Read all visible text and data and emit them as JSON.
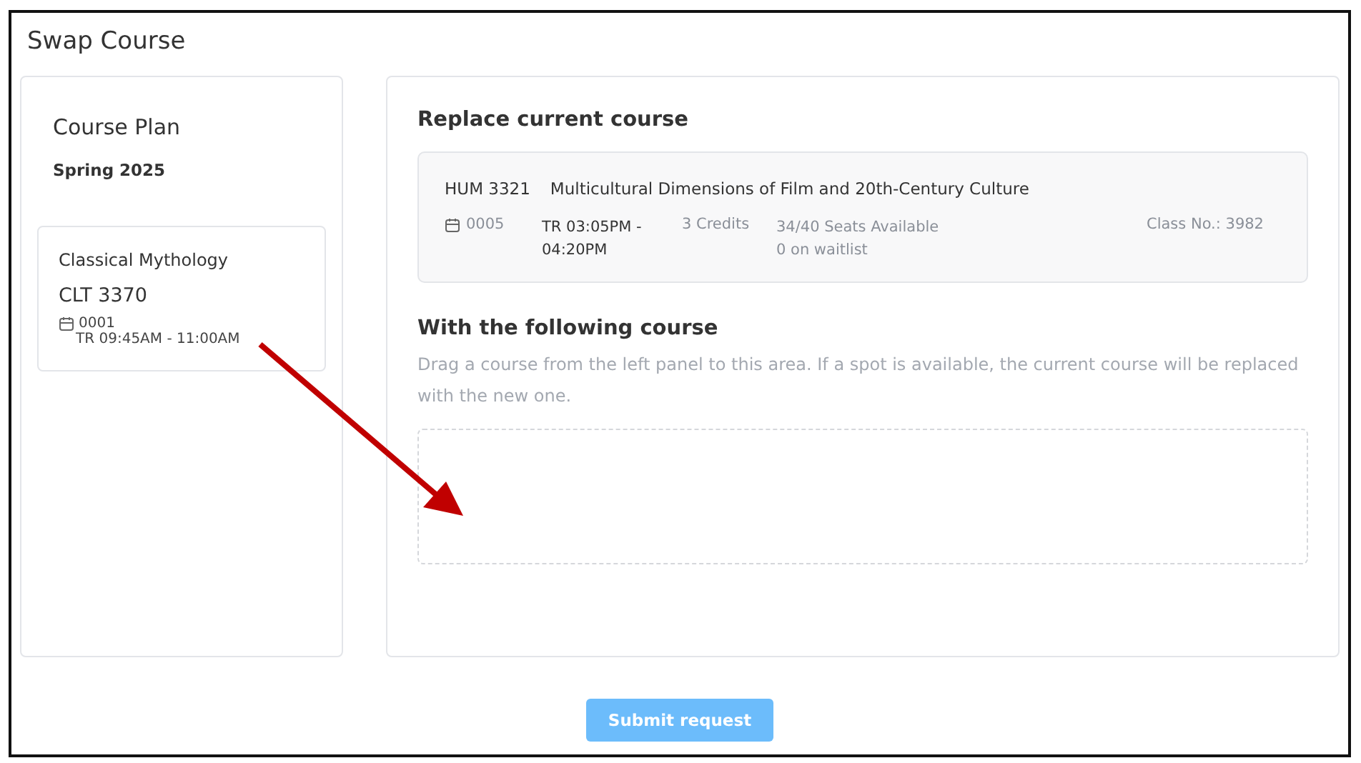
{
  "window": {
    "title": "Swap Course"
  },
  "course_plan": {
    "title": "Course Plan",
    "term": "Spring 2025",
    "courses": [
      {
        "name": "Classical Mythology",
        "code": "CLT 3370",
        "section": "0001",
        "schedule": "TR 09:45AM - 11:00AM"
      }
    ]
  },
  "replace": {
    "heading": "Replace current course",
    "course": {
      "code": "HUM 3321",
      "name": "Multicultural Dimensions of Film and 20th-Century Culture",
      "section": "0005",
      "schedule": "TR 03:05PM - 04:20PM",
      "credits": "3 Credits",
      "seats": "34/40 Seats Available",
      "waitlist": "0 on waitlist",
      "class_no": "Class No.: 3982"
    }
  },
  "target": {
    "heading": "With the following course",
    "hint": "Drag a course from the left panel to this area. If a spot is available, the current course will be replaced with the new one."
  },
  "submit": {
    "label": "Submit request",
    "disabled": true
  }
}
